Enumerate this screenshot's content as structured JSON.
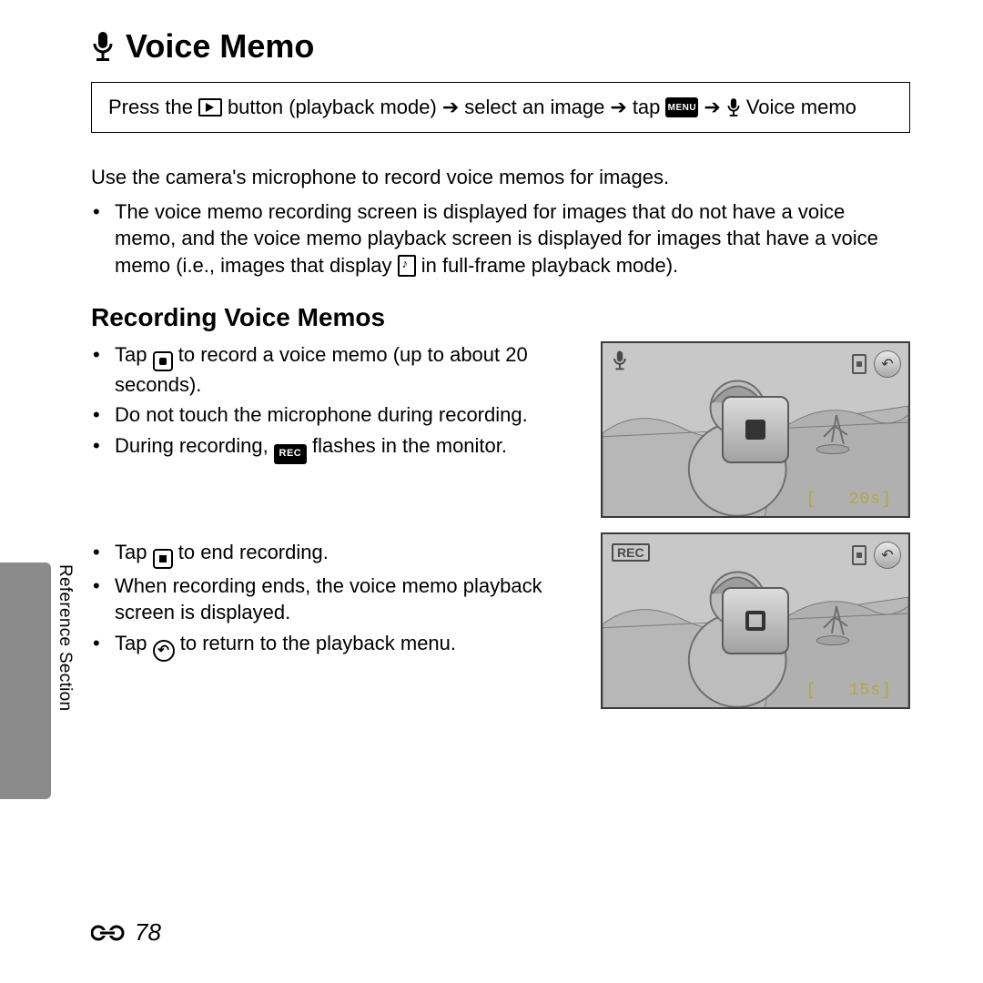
{
  "title": "Voice Memo",
  "nav": {
    "part1": "Press the",
    "part2": "button (playback mode)",
    "part3": "select an image",
    "part4": "tap",
    "part5": "Voice memo",
    "menuLabel": "MENU"
  },
  "intro": "Use the camera's microphone to record voice memos for images.",
  "introBullet": {
    "a": "The voice memo recording screen is displayed for images that do not have a voice memo, and the voice memo playback screen is displayed for images that have a voice memo (i.e., images that display",
    "b": "in full-frame playback mode)."
  },
  "subhead": "Recording Voice Memos",
  "steps1": {
    "s1a": "Tap",
    "s1b": "to record a voice memo (up to about 20 seconds).",
    "s2": "Do not touch the microphone during recording.",
    "s3a": "During recording,",
    "s3b": "flashes in the monitor.",
    "recLabel": "REC"
  },
  "steps2": {
    "s1a": "Tap",
    "s1b": "to end recording.",
    "s2": "When recording ends, the voice memo playback screen is displayed.",
    "s3a": "Tap",
    "s3b": "to return to the playback menu."
  },
  "screen1": {
    "time": "20s",
    "rec": ""
  },
  "screen2": {
    "time": "15s",
    "rec": "REC"
  },
  "sideLabel": "Reference Section",
  "pageNum": "78"
}
